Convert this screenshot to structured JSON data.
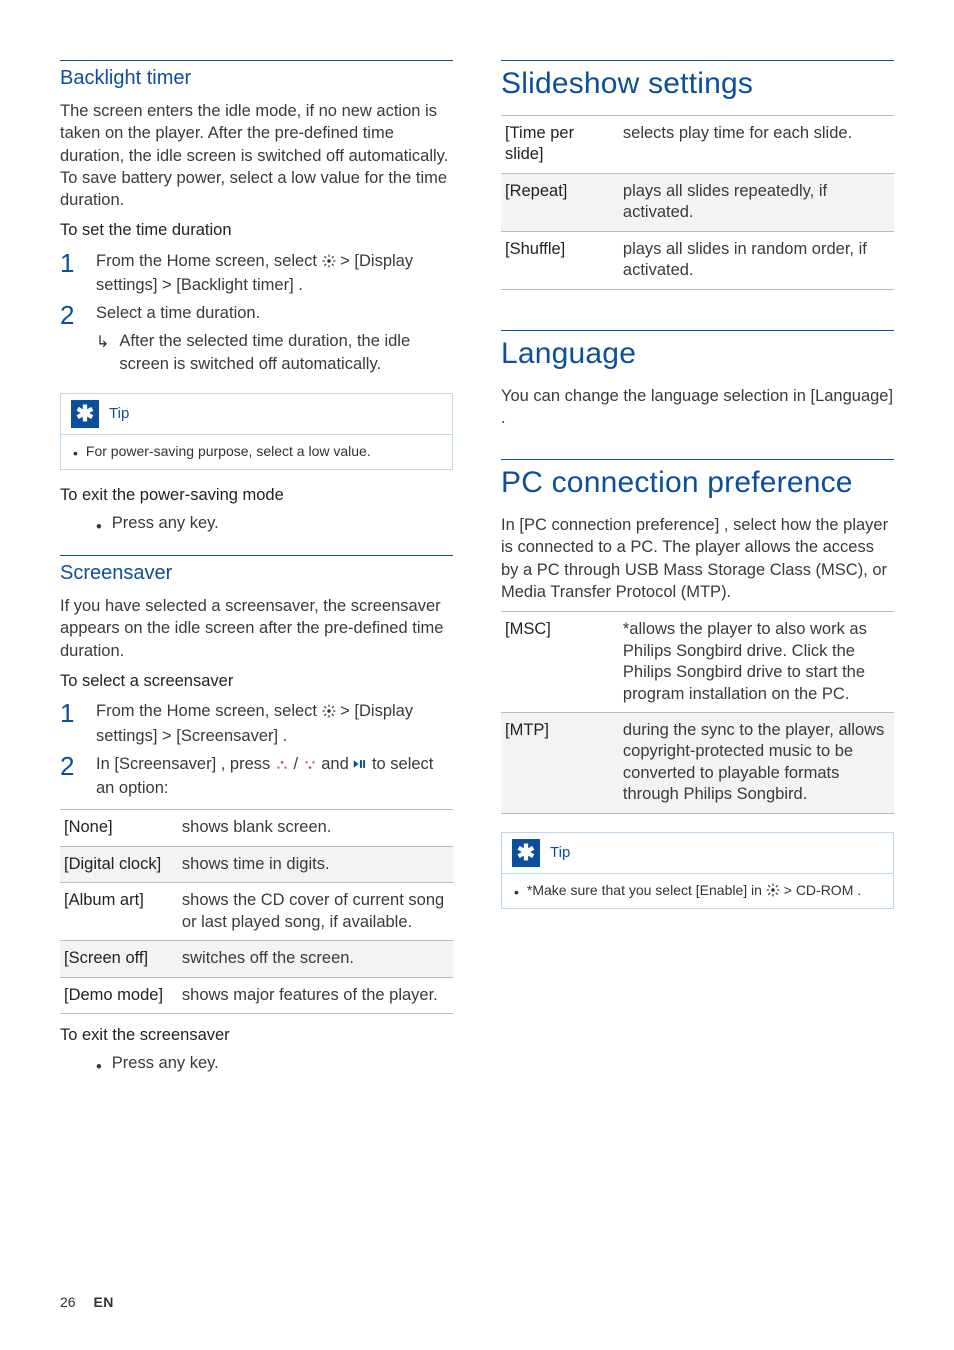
{
  "left": {
    "backlight": {
      "title": "Backlight timer",
      "intro": "The screen enters the idle mode, if no new action is taken on the player. After the pre-defined time duration, the idle screen is switched off automatically. To save battery power, select a low value for the time duration.",
      "setLead": "To set the time duration",
      "step1_a": "From the Home screen, select ",
      "step1_b": " > ",
      "step1_c": "[Display settings]",
      "step1_d": " > ",
      "step1_e": "[Backlight timer]",
      "step1_f": ".",
      "step2": "Select a time duration.",
      "step2_res": "After the selected time duration, the idle screen is switched off automatically.",
      "tipLabel": "Tip",
      "tipBody": "For power-saving purpose, select a low value.",
      "exitLead": "To exit the power-saving mode",
      "exitItem": "Press any key."
    },
    "screensaver": {
      "title": "Screensaver",
      "intro": "If you have selected a screensaver, the screensaver appears on the idle screen after the pre-defined time duration.",
      "selectLead": "To select a screensaver",
      "step1_a": "From the Home screen, select ",
      "step1_b": " > ",
      "step1_c": "[Display settings]",
      "step1_d": " > ",
      "step1_e": "[Screensaver]",
      "step1_f": ".",
      "step2_a": "In ",
      "step2_b": "[Screensaver]",
      "step2_c": ", press ",
      "step2_d": " / ",
      "step2_e": " and ",
      "step2_f": " to select an option:",
      "table": [
        {
          "k": "[None]",
          "v": "shows blank screen."
        },
        {
          "k": "[Digital clock]",
          "v": "shows time in digits."
        },
        {
          "k": "[Album art]",
          "v": "shows the CD cover of current song or last played song, if available."
        },
        {
          "k": "[Screen off]",
          "v": "switches off the screen."
        },
        {
          "k": "[Demo mode]",
          "v": "shows major features of the player."
        }
      ],
      "exitLead": "To exit the screensaver",
      "exitItem": "Press any key."
    }
  },
  "right": {
    "slideshow": {
      "title": "Slideshow settings",
      "table": [
        {
          "k": "[Time per slide]",
          "v": "selects play time for each slide."
        },
        {
          "k": "[Repeat]",
          "v": "plays all slides repeatedly, if activated."
        },
        {
          "k": "[Shuffle]",
          "v": "plays all slides in random order, if activated."
        }
      ]
    },
    "language": {
      "title": "Language",
      "body_a": "You can change the language selection in ",
      "body_b": "[Language]",
      "body_c": "."
    },
    "pc": {
      "title": "PC connection preference",
      "intro_a": "In ",
      "intro_b": "[PC connection preference]",
      "intro_c": ", select how the player is connected to a PC. The player allows the access by a PC through USB Mass Storage Class (MSC), or Media Transfer Protocol (MTP).",
      "table": [
        {
          "k": "[MSC]",
          "v_a": "*allows the player to also work as ",
          "v_b": "Philips Songbird",
          "v_c": " drive. Click the ",
          "v_d": "Philips Songbird",
          "v_e": " drive to start the program installation on the PC."
        },
        {
          "k": "[MTP]",
          "v_a": "during the sync to the player, allows copyright-protected music to be converted to playable formats through ",
          "v_b": "Philips Songbird",
          "v_c": "."
        }
      ],
      "tipLabel": "Tip",
      "tip_a": "*Make sure that you select ",
      "tip_b": "[Enable]",
      "tip_c": " in ",
      "tip_d": " > ",
      "tip_e": "CD-ROM",
      "tip_f": "."
    }
  },
  "footer": {
    "page": "26",
    "lang": "EN"
  }
}
